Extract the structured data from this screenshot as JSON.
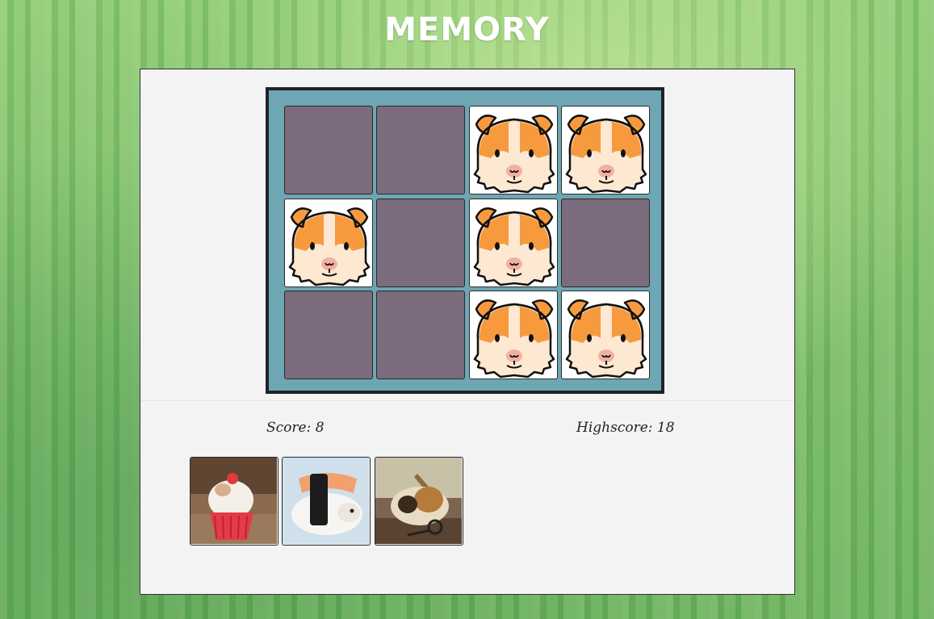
{
  "game": {
    "title": "MEMORY",
    "score_text": "Score: 8",
    "highscore_text": "Highscore: 18"
  },
  "board": {
    "rows": 3,
    "cols": 4,
    "cards": [
      {
        "state": "face-down"
      },
      {
        "state": "face-down"
      },
      {
        "state": "face-up",
        "face": "guinea-pig-icon"
      },
      {
        "state": "face-up",
        "face": "guinea-pig-icon"
      },
      {
        "state": "face-up",
        "face": "guinea-pig-icon"
      },
      {
        "state": "face-down"
      },
      {
        "state": "face-up",
        "face": "guinea-pig-icon"
      },
      {
        "state": "face-down"
      },
      {
        "state": "face-down"
      },
      {
        "state": "face-down"
      },
      {
        "state": "face-up",
        "face": "guinea-pig-icon"
      },
      {
        "state": "face-up",
        "face": "guinea-pig-icon"
      }
    ]
  },
  "matched_photos": [
    {
      "name": "guinea-pig-cupcake-photo"
    },
    {
      "name": "guinea-pig-sushi-photo"
    },
    {
      "name": "guinea-pig-detective-photo"
    }
  ],
  "colors": {
    "card_back": "#7a6c7d",
    "board_bg": "#6ea6b3",
    "board_border": "#1f2329",
    "panel_bg": "#f3f3f3",
    "page_bg": "#7fbf6a"
  }
}
